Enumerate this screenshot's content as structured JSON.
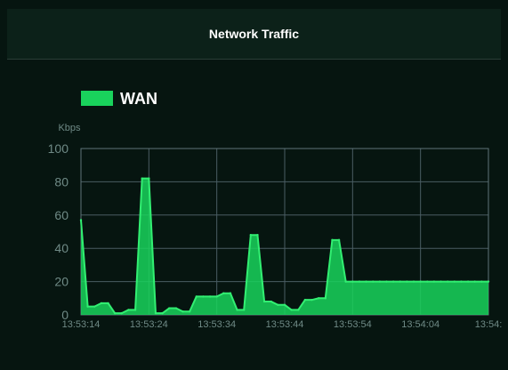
{
  "panel": {
    "title": "Network Traffic"
  },
  "chart_data": {
    "type": "area",
    "legend": [
      {
        "name": "WAN",
        "color": "#19d35c"
      }
    ],
    "ylabel": "Kbps",
    "ylim": [
      0,
      100
    ],
    "yticks": [
      0,
      20,
      40,
      60,
      80,
      100
    ],
    "xticks": [
      "13:53:14",
      "13:53:24",
      "13:53:34",
      "13:53:44",
      "13:53:54",
      "13:54:04",
      "13:54:"
    ],
    "grid": true,
    "series": [
      {
        "name": "WAN",
        "color": "#19d35c",
        "x": [
          0,
          1,
          2,
          3,
          4,
          5,
          6,
          7,
          8,
          9,
          10,
          11,
          12,
          13,
          14,
          15,
          16,
          17,
          18,
          19,
          20,
          21,
          22,
          23,
          24,
          25,
          26,
          27,
          28,
          29,
          30,
          31,
          32,
          33,
          34,
          35,
          36,
          37,
          38,
          39,
          40,
          41,
          42,
          43,
          44,
          45,
          46,
          47,
          48,
          49,
          50,
          51,
          52,
          53,
          54,
          55,
          56,
          57,
          58,
          59,
          60
        ],
        "values": [
          57,
          5,
          5,
          7,
          7,
          1,
          1,
          3,
          3,
          82,
          82,
          1,
          1,
          4,
          4,
          2,
          2,
          11,
          11,
          11,
          11,
          13,
          13,
          3,
          3,
          48,
          48,
          8,
          8,
          6,
          6,
          3,
          3,
          9,
          9,
          10,
          10,
          45,
          45,
          20,
          20,
          20,
          20,
          20,
          20,
          20,
          20,
          20,
          20,
          20,
          20,
          20,
          20,
          20,
          20,
          20,
          20,
          20,
          20,
          20,
          20
        ]
      }
    ]
  }
}
